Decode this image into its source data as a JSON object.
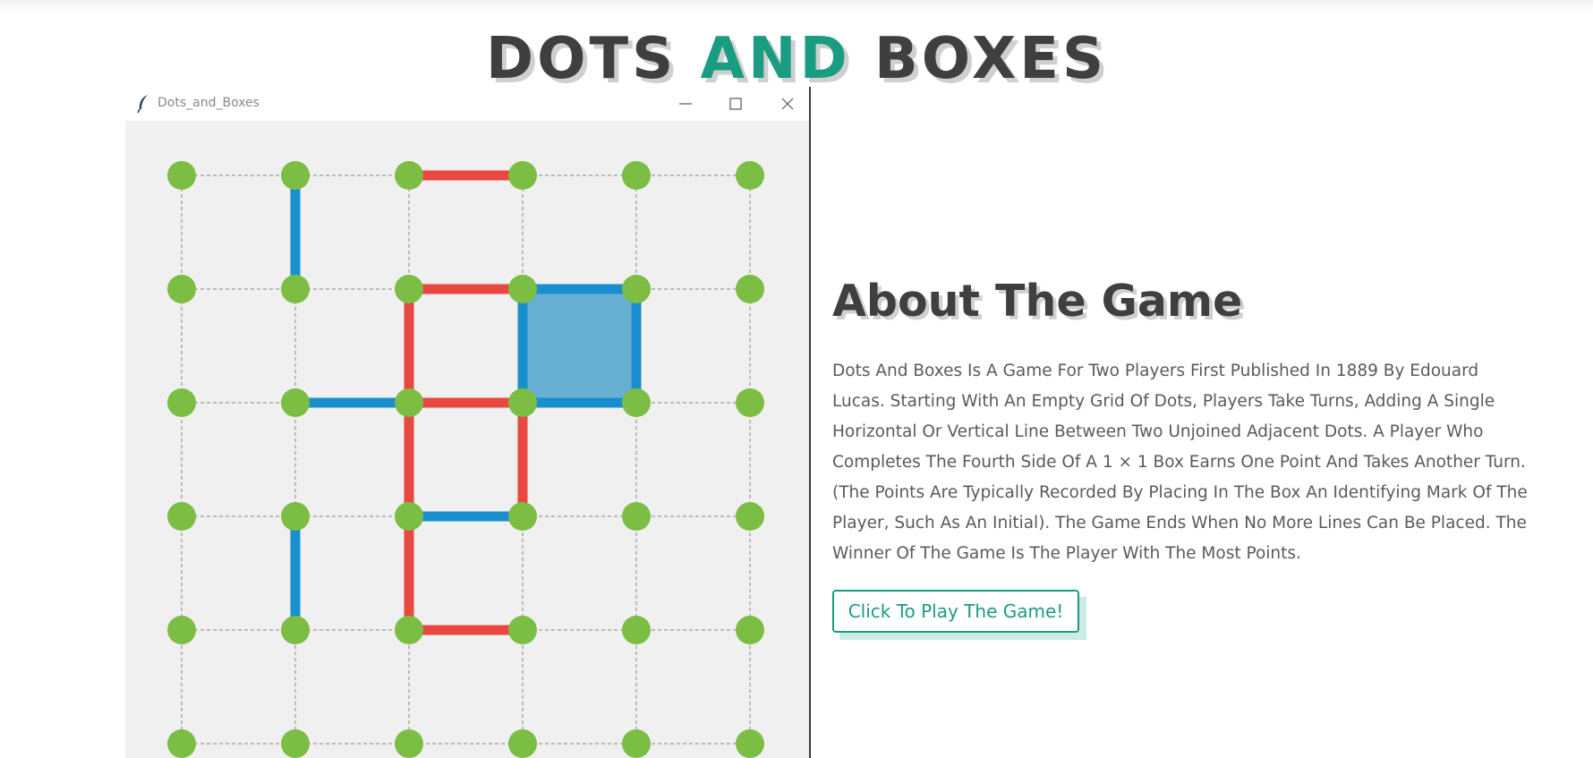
{
  "page": {
    "title_part1": "DOTS",
    "title_accent": "AND",
    "title_part2": "BOXES"
  },
  "window": {
    "title": "Dots_and_Boxes",
    "icon": "feather-icon",
    "controls": [
      "minimize-icon",
      "maximize-icon",
      "close-icon"
    ]
  },
  "board": {
    "dots_per_side": 6,
    "colors": {
      "background": "#f0f0f0",
      "dot": "#7cbd43",
      "guide": "#9a9a9a",
      "player1": "#1a8fd0",
      "player2": "#e8483f",
      "box_player1": "#68b0d2"
    },
    "edges": [
      {
        "from": [
          0,
          2
        ],
        "to": [
          0,
          3
        ],
        "player": 2
      },
      {
        "from": [
          0,
          1
        ],
        "to": [
          1,
          1
        ],
        "player": 1
      },
      {
        "from": [
          1,
          2
        ],
        "to": [
          1,
          3
        ],
        "player": 2
      },
      {
        "from": [
          1,
          3
        ],
        "to": [
          1,
          4
        ],
        "player": 1
      },
      {
        "from": [
          1,
          2
        ],
        "to": [
          2,
          2
        ],
        "player": 2
      },
      {
        "from": [
          1,
          3
        ],
        "to": [
          2,
          3
        ],
        "player": 1
      },
      {
        "from": [
          1,
          4
        ],
        "to": [
          2,
          4
        ],
        "player": 1
      },
      {
        "from": [
          2,
          1
        ],
        "to": [
          2,
          2
        ],
        "player": 1
      },
      {
        "from": [
          2,
          2
        ],
        "to": [
          2,
          3
        ],
        "player": 2
      },
      {
        "from": [
          2,
          3
        ],
        "to": [
          2,
          4
        ],
        "player": 1
      },
      {
        "from": [
          2,
          2
        ],
        "to": [
          3,
          2
        ],
        "player": 2
      },
      {
        "from": [
          2,
          3
        ],
        "to": [
          3,
          3
        ],
        "player": 2
      },
      {
        "from": [
          3,
          2
        ],
        "to": [
          3,
          3
        ],
        "player": 1
      },
      {
        "from": [
          3,
          1
        ],
        "to": [
          4,
          1
        ],
        "player": 1
      },
      {
        "from": [
          3,
          2
        ],
        "to": [
          4,
          2
        ],
        "player": 2
      },
      {
        "from": [
          4,
          2
        ],
        "to": [
          4,
          3
        ],
        "player": 2
      }
    ],
    "boxes": [
      {
        "row": 1,
        "col": 3,
        "player": 1
      }
    ]
  },
  "about": {
    "title": "About The Game",
    "text": "Dots And Boxes Is A Game For Two Players First Published In 1889 By Edouard Lucas. Starting With An Empty Grid Of Dots, Players Take Turns, Adding A Single Horizontal Or Vertical Line Between Two Unjoined Adjacent Dots. A Player Who Completes The Fourth Side Of A 1 × 1 Box Earns One Point And Takes Another Turn. (The Points Are Typically Recorded By Placing In The Box An Identifying Mark Of The Player, Such As An Initial). The Game Ends When No More Lines Can Be Placed. The Winner Of The Game Is The Player With The Most Points.",
    "button_label": "Click To Play The Game!"
  }
}
